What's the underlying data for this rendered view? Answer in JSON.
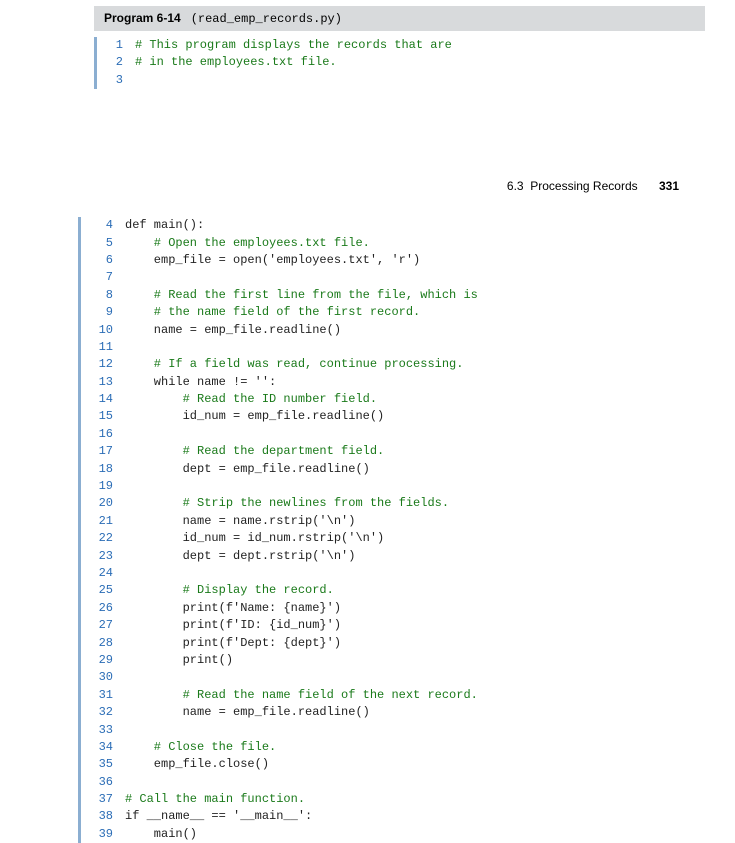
{
  "program": {
    "label": "Program 6-14",
    "filename": "(read_emp_records.py)"
  },
  "page_header": {
    "section": "6.3  Processing Records",
    "page": "331"
  },
  "top_lines": [
    {
      "n": "1",
      "t": "# This program displays the records that are"
    },
    {
      "n": "2",
      "t": "# in the employees.txt file."
    },
    {
      "n": "3",
      "t": ""
    }
  ],
  "bottom_lines": [
    {
      "n": "4",
      "t": "def main():"
    },
    {
      "n": "5",
      "t": "    # Open the employees.txt file.",
      "c": true
    },
    {
      "n": "6",
      "t": "    emp_file = open('employees.txt', 'r')"
    },
    {
      "n": "7",
      "t": ""
    },
    {
      "n": "8",
      "t": "    # Read the first line from the file, which is",
      "c": true
    },
    {
      "n": "9",
      "t": "    # the name field of the first record.",
      "c": true
    },
    {
      "n": "10",
      "t": "    name = emp_file.readline()"
    },
    {
      "n": "11",
      "t": ""
    },
    {
      "n": "12",
      "t": "    # If a field was read, continue processing.",
      "c": true
    },
    {
      "n": "13",
      "t": "    while name != '':"
    },
    {
      "n": "14",
      "t": "        # Read the ID number field.",
      "c": true
    },
    {
      "n": "15",
      "t": "        id_num = emp_file.readline()"
    },
    {
      "n": "16",
      "t": ""
    },
    {
      "n": "17",
      "t": "        # Read the department field.",
      "c": true
    },
    {
      "n": "18",
      "t": "        dept = emp_file.readline()"
    },
    {
      "n": "19",
      "t": ""
    },
    {
      "n": "20",
      "t": "        # Strip the newlines from the fields.",
      "c": true
    },
    {
      "n": "21",
      "t": "        name = name.rstrip('\\n')"
    },
    {
      "n": "22",
      "t": "        id_num = id_num.rstrip('\\n')"
    },
    {
      "n": "23",
      "t": "        dept = dept.rstrip('\\n')"
    },
    {
      "n": "24",
      "t": ""
    },
    {
      "n": "25",
      "t": "        # Display the record.",
      "c": true
    },
    {
      "n": "26",
      "t": "        print(f'Name: {name}')"
    },
    {
      "n": "27",
      "t": "        print(f'ID: {id_num}')"
    },
    {
      "n": "28",
      "t": "        print(f'Dept: {dept}')"
    },
    {
      "n": "29",
      "t": "        print()"
    },
    {
      "n": "30",
      "t": ""
    },
    {
      "n": "31",
      "t": "        # Read the name field of the next record.",
      "c": true
    },
    {
      "n": "32",
      "t": "        name = emp_file.readline()"
    },
    {
      "n": "33",
      "t": ""
    },
    {
      "n": "34",
      "t": "    # Close the file.",
      "c": true
    },
    {
      "n": "35",
      "t": "    emp_file.close()"
    },
    {
      "n": "36",
      "t": ""
    },
    {
      "n": "37",
      "t": "# Call the main function.",
      "c": true
    },
    {
      "n": "38",
      "t": "if __name__ == '__main__':"
    },
    {
      "n": "39",
      "t": "    main()"
    }
  ]
}
